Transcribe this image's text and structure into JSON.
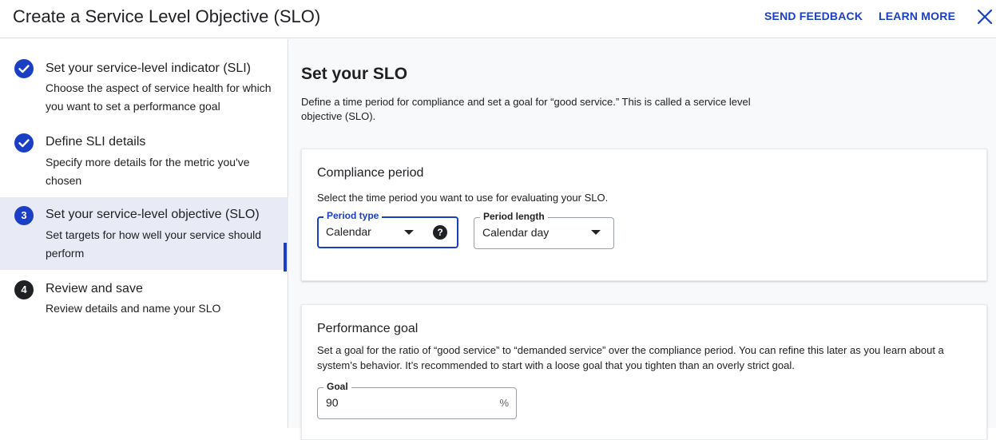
{
  "header": {
    "title": "Create a Service Level Objective (SLO)",
    "send_feedback": "SEND FEEDBACK",
    "learn_more": "LEARN MORE"
  },
  "steps": [
    {
      "status": "done",
      "title": "Set your service-level indicator (SLI)",
      "desc": "Choose the aspect of service health for which you want to set a performance goal"
    },
    {
      "status": "done",
      "title": "Define SLI details",
      "desc": "Specify more details for the metric you've chosen"
    },
    {
      "status": "active",
      "number": "3",
      "title": "Set your service-level objective (SLO)",
      "desc": "Set targets for how well your service should perform"
    },
    {
      "status": "todo",
      "number": "4",
      "title": "Review and save",
      "desc": "Review details and name your SLO"
    }
  ],
  "main": {
    "title": "Set your SLO",
    "desc": "Define a time period for compliance and set a goal for “good service.” This is called a service level objective (SLO)."
  },
  "compliance": {
    "title": "Compliance period",
    "desc": "Select the time period you want to use for evaluating your SLO.",
    "period_type_label": "Period type",
    "period_type_value": "Calendar",
    "period_length_label": "Period length",
    "period_length_value": "Calendar day"
  },
  "performance": {
    "title": "Performance goal",
    "desc": "Set a goal for the ratio of “good service” to “demanded service” over the compliance period. You can refine this later as you learn about a system’s behavior. It’s recommended to start with a loose goal that you tighten than an overly strict goal.",
    "goal_label": "Goal",
    "goal_value": "90",
    "goal_suffix": "%"
  },
  "colors": {
    "accent": "#1a3fc4",
    "active_step_bg": "#e8eaf6"
  }
}
